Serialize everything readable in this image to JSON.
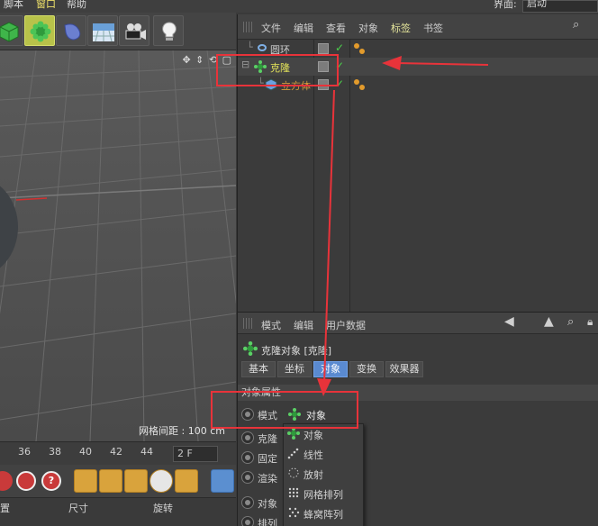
{
  "menubar": {
    "items": [
      "脚本",
      "窗口",
      "帮助"
    ],
    "interface_label": "界面:",
    "interface_value": "启动"
  },
  "toolbar": {
    "buttons": [
      "cube-icon",
      "cloner-icon",
      "deformer-icon",
      "floor-icon",
      "camera-icon",
      "light-icon"
    ]
  },
  "viewport": {
    "grid_info": "网格间距 : 100 cm",
    "hud": "✥ ⇕ ⟲ ▢"
  },
  "timeline": {
    "ticks": [
      "36",
      "38",
      "40",
      "42",
      "44"
    ],
    "frame": "2 F"
  },
  "coords": {
    "col1": "置",
    "col2": "尺寸",
    "col3": "旋转"
  },
  "object_manager": {
    "menu": [
      "文件",
      "编辑",
      "查看",
      "对象",
      "标签",
      "书签"
    ],
    "active_menu": "标签",
    "objects": [
      {
        "name": "圆环",
        "color": "#cfcfcf",
        "icon": "torus-icon"
      },
      {
        "name": "克隆",
        "color": "#e3e35a",
        "icon": "cloner-icon"
      },
      {
        "name": "立方体",
        "color": "#d39a3c",
        "icon": "cube-icon"
      }
    ]
  },
  "attributes": {
    "menu": [
      "模式",
      "编辑",
      "用户数据"
    ],
    "title": "克隆对象 [克隆]",
    "tabs": [
      "基本",
      "坐标",
      "对象",
      "变换",
      "效果器"
    ],
    "active_tab": "对象",
    "section": "对象属性",
    "mode_label": "模式",
    "mode_value": "对象",
    "properties": [
      "克隆",
      "固定",
      "渲染",
      "对象",
      "排列"
    ],
    "dropdown": [
      "对象",
      "线性",
      "放射",
      "网格排列",
      "蜂窝阵列"
    ]
  }
}
